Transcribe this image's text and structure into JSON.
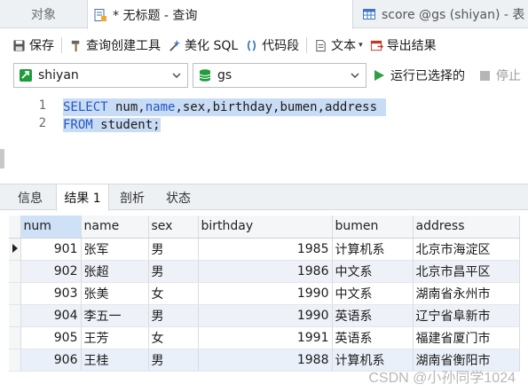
{
  "window_tabs": [
    {
      "label": "对象",
      "icon": "none"
    },
    {
      "label": "* 无标题 - 查询",
      "icon": "query-icon"
    },
    {
      "label": "score @gs (shiyan) - 表",
      "icon": "table-icon"
    }
  ],
  "toolbar": {
    "save": "保存",
    "query_builder": "查询创建工具",
    "beautify_sql": "美化 SQL",
    "code_snippet": "代码段",
    "text": "文本",
    "export": "导出结果"
  },
  "connection": {
    "connection_value": "shiyan",
    "database_value": "gs",
    "run_selected": "运行已选择的",
    "stop": "停止"
  },
  "editor": {
    "line_numbers": [
      "1",
      "2"
    ],
    "line1_keyword": "SELECT",
    "line1_rest_before": " num,",
    "line1_field_name": "name",
    "line1_rest_after": ",sex,birthday,bumen,address",
    "line2_keyword": "FROM",
    "line2_rest": " student;"
  },
  "result_tabs": [
    "信息",
    "结果 1",
    "剖析",
    "状态"
  ],
  "grid": {
    "columns": [
      "num",
      "name",
      "sex",
      "birthday",
      "bumen",
      "address"
    ],
    "rows": [
      [
        "901",
        "张军",
        "男",
        "1985",
        "计算机系",
        "北京市海淀区"
      ],
      [
        "902",
        "张超",
        "男",
        "1986",
        "中文系",
        "北京市昌平区"
      ],
      [
        "903",
        "张美",
        "女",
        "1990",
        "中文系",
        "湖南省永州市"
      ],
      [
        "904",
        "李五一",
        "男",
        "1990",
        "英语系",
        "辽宁省阜新市"
      ],
      [
        "905",
        "王芳",
        "女",
        "1991",
        "英语系",
        "福建省厦门市"
      ],
      [
        "906",
        "王桂",
        "男",
        "1988",
        "计算机系",
        "湖南省衡阳市"
      ]
    ]
  },
  "watermark": "CSDN @小孙同学1024",
  "colors": {
    "keyword": "#2457c5",
    "selection": "#c9dcf5",
    "run_green": "#2ea043",
    "database_green": "#1f9d3a"
  }
}
